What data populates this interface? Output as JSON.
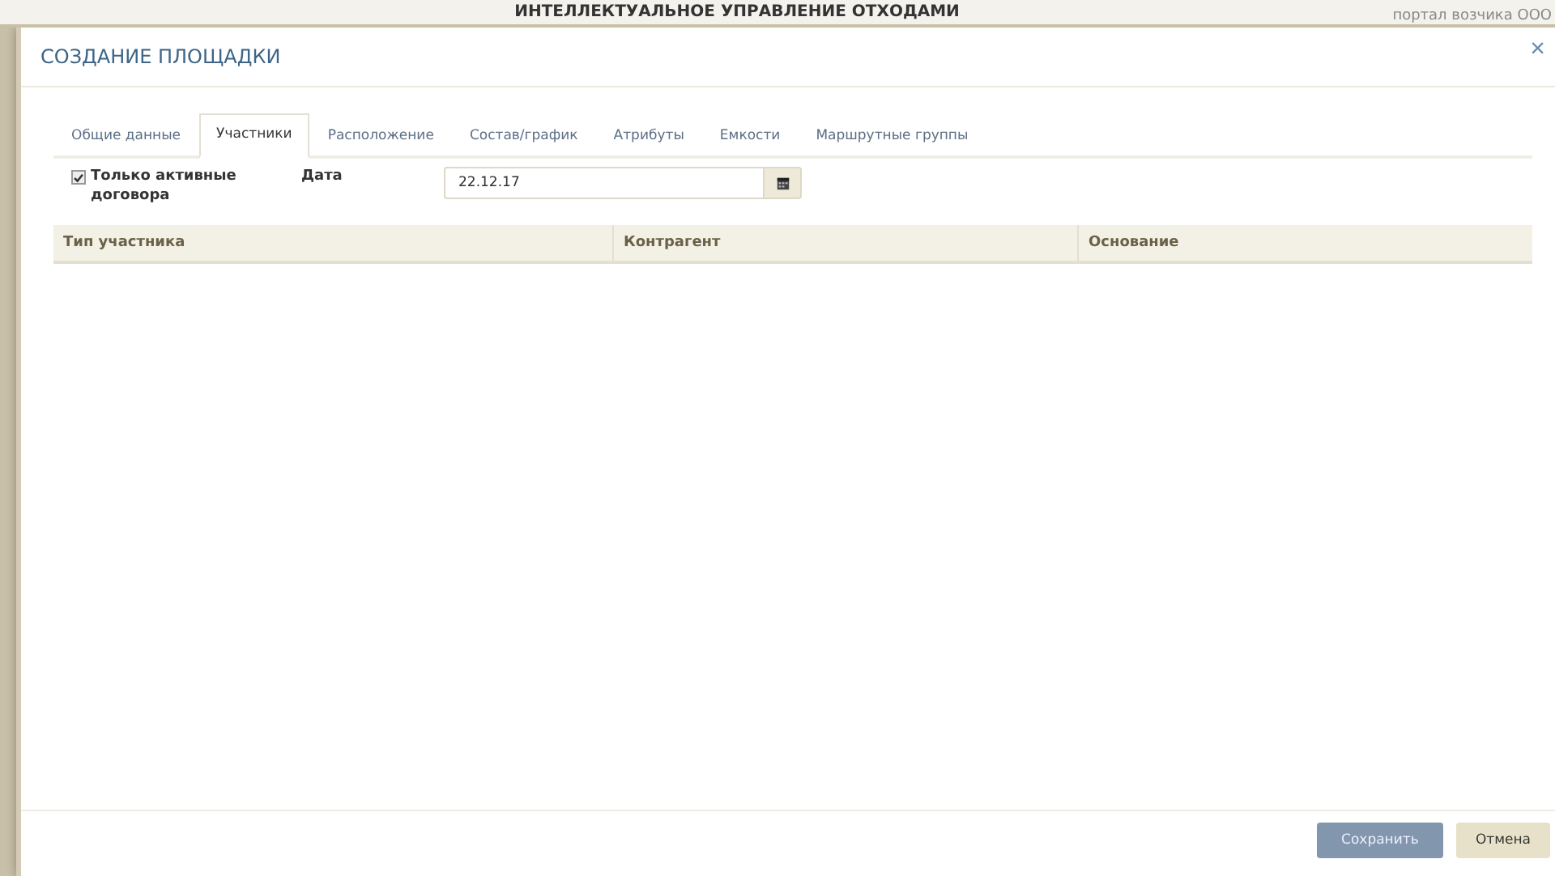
{
  "page_header": {
    "title": "ИНТЕЛЛЕКТУАЛЬНОЕ УПРАВЛЕНИЕ ОТХОДАМИ",
    "portal": "портал возчика ООО"
  },
  "dialog": {
    "title": "СОЗДАНИЕ ПЛОЩАДКИ",
    "close": "×"
  },
  "tabs": [
    {
      "label": "Общие данные",
      "selected": false
    },
    {
      "label": "Участники",
      "selected": true
    },
    {
      "label": "Расположение",
      "selected": false
    },
    {
      "label": "Состав/график",
      "selected": false
    },
    {
      "label": "Атрибуты",
      "selected": false
    },
    {
      "label": "Емкости",
      "selected": false
    },
    {
      "label": "Маршрутные группы",
      "selected": false
    }
  ],
  "filter": {
    "active_only": {
      "label": "Только активные договора",
      "checked": true
    },
    "date": {
      "label": "Дата",
      "value": "22.12.17"
    }
  },
  "table": {
    "columns": [
      "Тип участника",
      "Контрагент",
      "Основание"
    ]
  },
  "buttons": [
    {
      "label": "Сохранить",
      "kind": "primary"
    },
    {
      "label": "Отмена",
      "kind": "secondary"
    }
  ]
}
